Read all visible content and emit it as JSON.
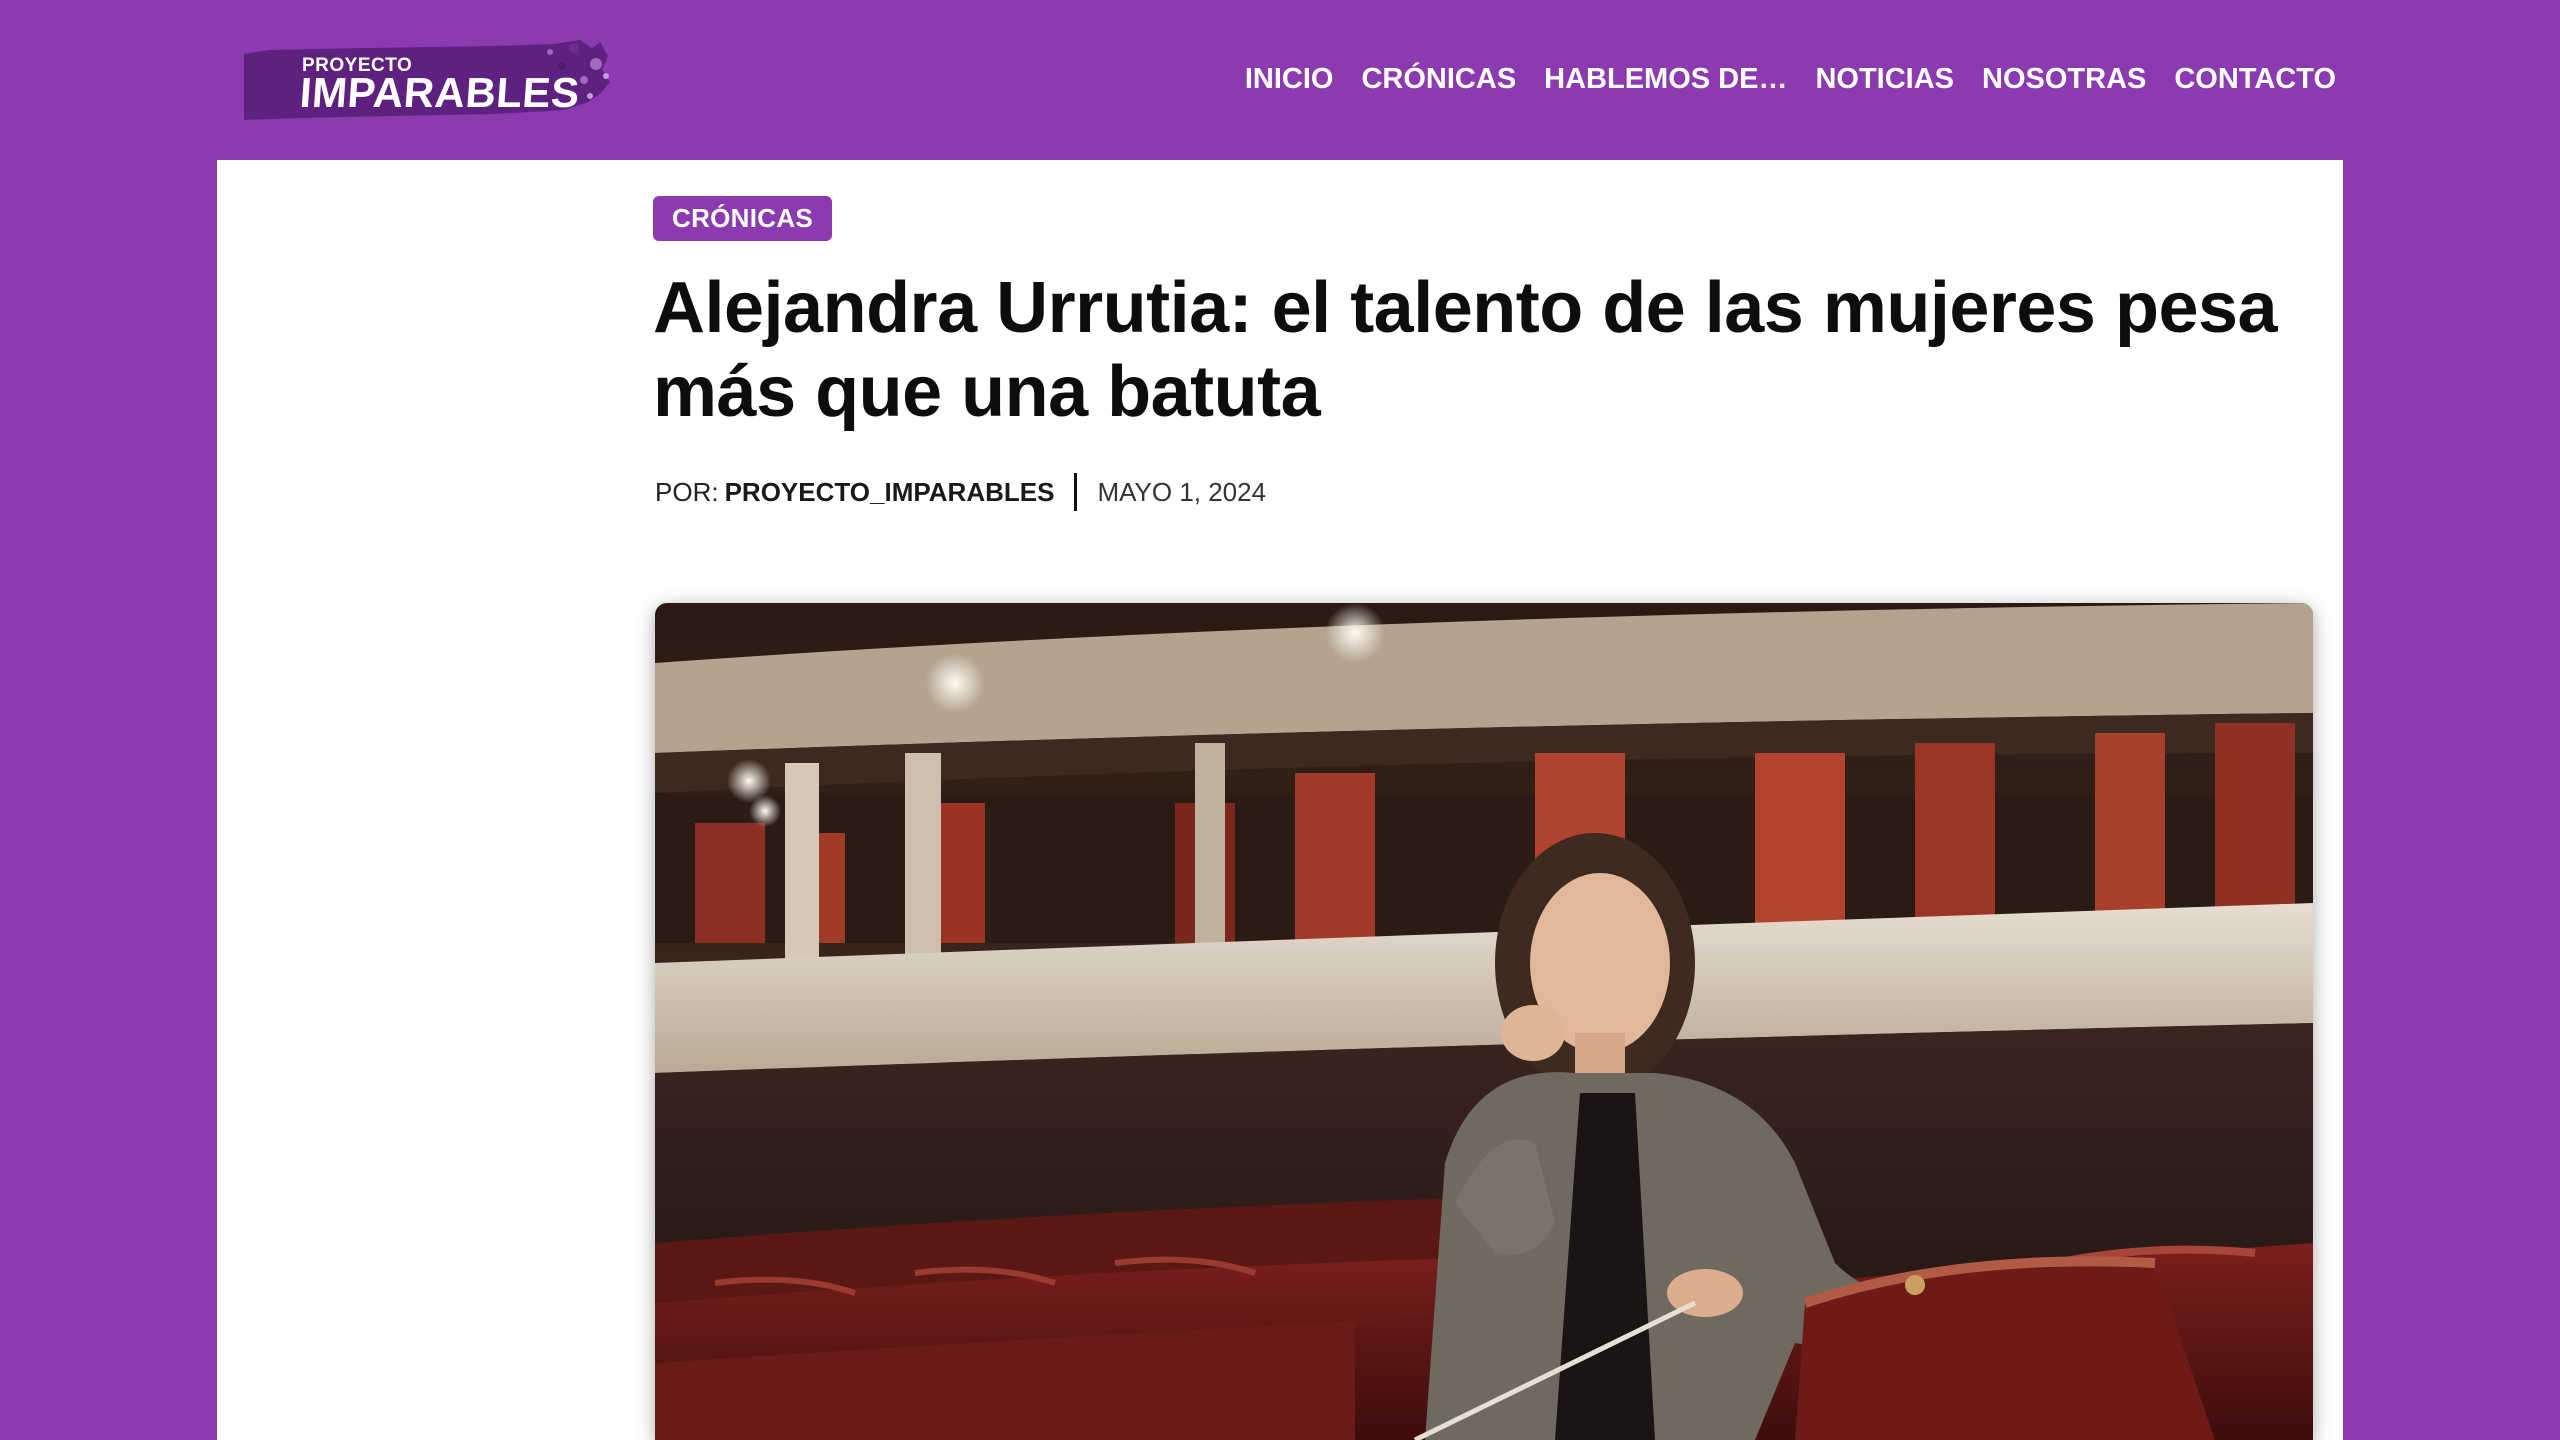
{
  "header": {
    "logo": {
      "line1": "PROYECTO",
      "line2": "IMPARABLES"
    },
    "nav": [
      {
        "label": "INICIO"
      },
      {
        "label": "CRÓNICAS"
      },
      {
        "label": "HABLEMOS DE…"
      },
      {
        "label": "NOTICIAS"
      },
      {
        "label": "NOSOTRAS"
      },
      {
        "label": "CONTACTO"
      }
    ]
  },
  "article": {
    "category": "CRÓNICAS",
    "title": "Alejandra Urrutia: el talento de las mujeres pesa más que una batuta",
    "meta": {
      "by_prefix": "POR:",
      "author": "PROYECTO_IMPARABLES",
      "date": "MAYO 1, 2024"
    }
  },
  "colors": {
    "brand": "#8c3ab0",
    "brand_dark": "#5f2180",
    "card": "#ffffff",
    "text": "#0d0d0d"
  },
  "icons": {
    "logo": "brush-stroke-logo",
    "photo": "conductor-in-theater-photo"
  }
}
